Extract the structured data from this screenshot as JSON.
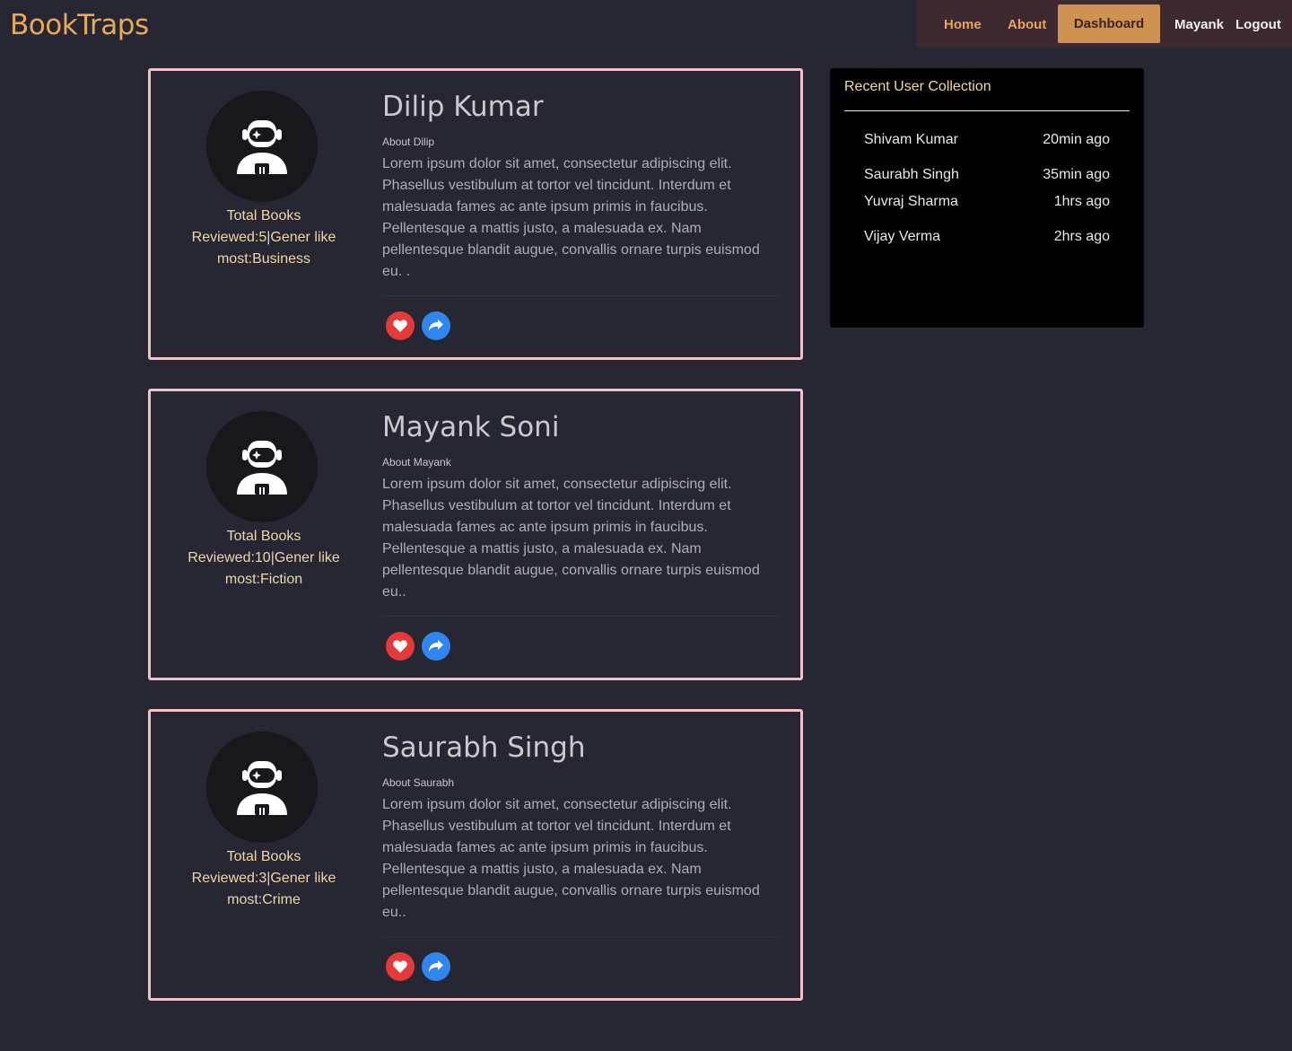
{
  "app": {
    "brand": "BookTraps"
  },
  "nav": {
    "home": "Home",
    "about": "About",
    "dashboard": "Dashboard",
    "user": "Mayank",
    "logout": "Logout"
  },
  "cards": [
    {
      "name": "Dilip Kumar",
      "about_label": "About Dilip",
      "about_text": "Lorem ipsum dolor sit amet, consectetur adipiscing elit. Phasellus vestibulum at tortor vel tincidunt. Interdum et malesuada fames ac ante ipsum primis in faucibus. Pellentesque a mattis justo, a malesuada ex. Nam pellentesque blandit augue, convallis ornare turpis euismod eu. .",
      "stats": "Total Books Reviewed:5|Gener like most:Business"
    },
    {
      "name": "Mayank Soni",
      "about_label": "About Mayank",
      "about_text": "Lorem ipsum dolor sit amet, consectetur adipiscing elit. Phasellus vestibulum at tortor vel tincidunt. Interdum et malesuada fames ac ante ipsum primis in faucibus. Pellentesque a mattis justo, a malesuada ex. Nam pellentesque blandit augue, convallis ornare turpis euismod eu..",
      "stats": "Total Books Reviewed:10|Gener like most:Fiction"
    },
    {
      "name": "Saurabh Singh",
      "about_label": "About Saurabh",
      "about_text": "Lorem ipsum dolor sit amet, consectetur adipiscing elit. Phasellus vestibulum at tortor vel tincidunt. Interdum et malesuada fames ac ante ipsum primis in faucibus. Pellentesque a mattis justo, a malesuada ex. Nam pellentesque blandit augue, convallis ornare turpis euismod eu..",
      "stats": "Total Books Reviewed:3|Gener like most:Crime"
    }
  ],
  "sidebar": {
    "title": "Recent User Collection",
    "items": [
      {
        "name": "Shivam Kumar",
        "time": "20min ago"
      },
      {
        "name": "Saurabh Singh",
        "time": "35min ago"
      },
      {
        "name": "Yuvraj Sharma",
        "time": "1hrs ago"
      },
      {
        "name": "Vijay Verma",
        "time": "2hrs ago"
      }
    ]
  },
  "icons": {
    "avatar": "astronaut-icon",
    "like": "heart-icon",
    "share": "share-icon"
  },
  "colors": {
    "brand": "#e9a95a",
    "background": "#262732",
    "card_border": "#f3c1cb",
    "like": "#e63a3a",
    "share": "#2f86ef",
    "dashboard_button": "#d09250"
  }
}
